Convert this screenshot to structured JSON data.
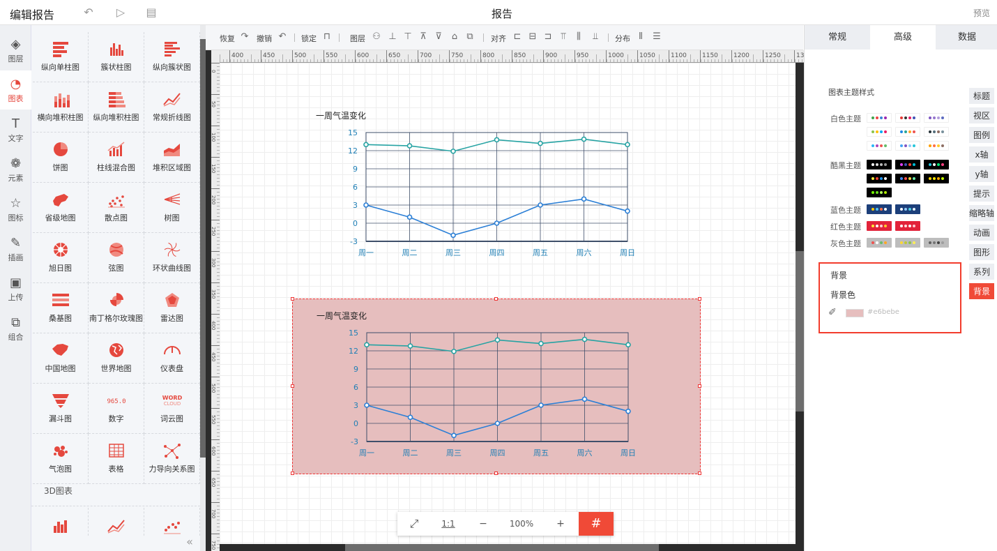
{
  "app": {
    "title": "编辑报告",
    "page_title": "报告",
    "preview": "预览"
  },
  "topbar_icons": [
    "undo-icon",
    "play-icon",
    "save-icon"
  ],
  "leftnav": [
    {
      "label": "图层",
      "icon": "layers-icon",
      "glyph": "◈"
    },
    {
      "label": "图表",
      "icon": "chart-icon",
      "glyph": "◔",
      "active": true
    },
    {
      "label": "文字",
      "icon": "text-icon",
      "glyph": "T"
    },
    {
      "label": "元素",
      "icon": "shapes-icon",
      "glyph": "❁"
    },
    {
      "label": "图标",
      "icon": "star-icon",
      "glyph": "☆"
    },
    {
      "label": "插画",
      "icon": "palette-icon",
      "glyph": "✎"
    },
    {
      "label": "上传",
      "icon": "image-upload-icon",
      "glyph": "▣"
    },
    {
      "label": "组合",
      "icon": "group-icon",
      "glyph": "⧉"
    }
  ],
  "palette": {
    "items": [
      {
        "label": "纵向单柱图",
        "icon": "bar-h-icon"
      },
      {
        "label": "簇状柱图",
        "icon": "bar-cluster-icon"
      },
      {
        "label": "纵向簇状图",
        "icon": "bar-h-cluster-icon"
      },
      {
        "label": "横向堆积柱图",
        "icon": "bar-stack-icon"
      },
      {
        "label": "纵向堆积柱图",
        "icon": "bar-h-stack-icon"
      },
      {
        "label": "常规折线图",
        "icon": "line-icon"
      },
      {
        "label": "饼图",
        "icon": "pie-icon"
      },
      {
        "label": "柱线混合图",
        "icon": "bar-line-icon"
      },
      {
        "label": "堆积区域图",
        "icon": "area-icon"
      },
      {
        "label": "省级地图",
        "icon": "province-map-icon"
      },
      {
        "label": "散点图",
        "icon": "scatter-icon"
      },
      {
        "label": "树图",
        "icon": "tree-icon"
      },
      {
        "label": "旭日图",
        "icon": "sunburst-icon"
      },
      {
        "label": "弦图",
        "icon": "chord-icon"
      },
      {
        "label": "环状曲线图",
        "icon": "ring-curve-icon"
      },
      {
        "label": "桑基图",
        "icon": "sankey-icon"
      },
      {
        "label": "南丁格尔玫瑰图",
        "icon": "rose-icon"
      },
      {
        "label": "雷达图",
        "icon": "radar-icon"
      },
      {
        "label": "中国地图",
        "icon": "china-map-icon"
      },
      {
        "label": "世界地图",
        "icon": "world-map-icon"
      },
      {
        "label": "仪表盘",
        "icon": "gauge-icon"
      },
      {
        "label": "漏斗图",
        "icon": "funnel-icon"
      },
      {
        "label": "数字",
        "icon": "number-icon"
      },
      {
        "label": "词云图",
        "icon": "wordcloud-icon"
      },
      {
        "label": "气泡图",
        "icon": "bubble-icon"
      },
      {
        "label": "表格",
        "icon": "table-icon"
      },
      {
        "label": "力导向关系图",
        "icon": "force-graph-icon"
      }
    ],
    "number_glyph": "965.0",
    "wordcloud_glyph": "WORD CLOUD",
    "section_3d": "3D图表",
    "items_3d": [
      {
        "icon": "bar-3d-icon"
      },
      {
        "icon": "line-3d-icon"
      },
      {
        "icon": "scatter-3d-icon"
      }
    ],
    "collapse": "«"
  },
  "toolbar": {
    "redo": "恢复",
    "undo": "撤销",
    "lock": "锁定",
    "layer": "图层",
    "align": "对齐",
    "distribute": "分布"
  },
  "ruler": {
    "h_labels": [
      "400",
      "450",
      "500",
      "550",
      "600",
      "650",
      "700",
      "750",
      "800",
      "850",
      "900",
      "950",
      "1000",
      "1050",
      "1100",
      "1150",
      "1200",
      "1250",
      "1300"
    ]
  },
  "zoom": {
    "fit": "⤢",
    "one_to_one": "1:1",
    "minus": "−",
    "level": "100%",
    "plus": "+",
    "grid": "#"
  },
  "right": {
    "tabs": [
      "常规",
      "高级",
      "数据"
    ],
    "active_tab": 1,
    "theme_title": "图表主题样式",
    "theme_rows": [
      {
        "label": "白色主题",
        "swatches": [
          {
            "bg": "#ffffff",
            "dots": [
              "#3fa34d",
              "#e44",
              "#3b82d6",
              "#9c27b0"
            ]
          },
          {
            "bg": "#ffffff",
            "dots": [
              "#e53935",
              "#333",
              "#e91e63",
              "#3f51b5"
            ]
          },
          {
            "bg": "#ffffff",
            "dots": [
              "#7e57c2",
              "#9575cd",
              "#b39ddb",
              "#5c6bc0"
            ]
          },
          {
            "bg": "#ffffff",
            "dots": [
              "#8bc34a",
              "#ffc107",
              "#03a9f4",
              "#e91e63"
            ]
          },
          {
            "bg": "#ffffff",
            "dots": [
              "#1e88e5",
              "#26a69a",
              "#ffa726",
              "#ef5350"
            ]
          },
          {
            "bg": "#ffffff",
            "dots": [
              "#263238",
              "#546e7a",
              "#8d6e63",
              "#78909c"
            ]
          },
          {
            "bg": "#ffffff",
            "dots": [
              "#29b6f6",
              "#ab47bc",
              "#ef5350",
              "#66bb6a"
            ]
          },
          {
            "bg": "#ffffff",
            "dots": [
              "#42a5f5",
              "#7e57c2",
              "#90caf9",
              "#26c6da"
            ]
          },
          {
            "bg": "#ffffff",
            "dots": [
              "#ffa000",
              "#ff7043",
              "#ffca28",
              "#8d6e63"
            ]
          }
        ]
      },
      {
        "label": "酷黑主题",
        "swatches": [
          {
            "bg": "#000000",
            "dots": [
              "#fff",
              "#ddd",
              "#bbb",
              "#999"
            ]
          },
          {
            "bg": "#000000",
            "dots": [
              "#e040fb",
              "#3f51b5",
              "#f44336",
              "#00bcd4"
            ]
          },
          {
            "bg": "#000000",
            "dots": [
              "#26c6da",
              "#fff",
              "#00e676",
              "#ff4081"
            ]
          },
          {
            "bg": "#000000",
            "dots": [
              "#ffeb3b",
              "#f44336",
              "#2196f3",
              "#fff"
            ]
          },
          {
            "bg": "#000000",
            "dots": [
              "#448aff",
              "#ff5252",
              "#ffd740",
              "#69f0ae"
            ]
          },
          {
            "bg": "#000000",
            "dots": [
              "#ffd600",
              "#ffea00",
              "#ffab00",
              "#c6ff00"
            ]
          },
          {
            "bg": "#000000",
            "dots": [
              "#76ff03",
              "#64dd17",
              "#b2ff59",
              "#aeea00"
            ]
          }
        ]
      },
      {
        "label": "蓝色主题",
        "swatches": [
          {
            "bg": "#1c3f7a",
            "dots": [
              "#ffcc00",
              "#4fc3f7",
              "#ff7043",
              "#fff"
            ]
          },
          {
            "bg": "#1c3f7a",
            "dots": [
              "#fff",
              "#90caf9",
              "#4dd0e1",
              "#e3f2fd"
            ]
          }
        ]
      },
      {
        "label": "红色主题",
        "swatches": [
          {
            "bg": "#e2233a",
            "dots": [
              "#ffeb3b",
              "#fff",
              "#ffcdd2",
              "#ffca28"
            ]
          },
          {
            "bg": "#e2233a",
            "dots": [
              "#fff",
              "#ffe0e0",
              "#fff",
              "#ffcdd2"
            ]
          }
        ]
      },
      {
        "label": "灰色主题",
        "swatches": [
          {
            "bg": "#bdbdbd",
            "dots": [
              "#ef5350",
              "#fff",
              "#66bb6a",
              "#ffa726"
            ]
          },
          {
            "bg": "#bdbdbd",
            "dots": [
              "#fdd835",
              "#c0ca33",
              "#8bc34a",
              "#ffee58"
            ]
          },
          {
            "bg": "#bdbdbd",
            "dots": [
              "#616161",
              "#757575",
              "#424242",
              "#9e9e9e"
            ]
          }
        ]
      }
    ],
    "side_tabs": [
      "标题",
      "视区",
      "图例",
      "x轴",
      "y轴",
      "提示",
      "缩略轴",
      "动画",
      "图形",
      "系列",
      "背景"
    ],
    "active_side_tab": 10,
    "bg_section": {
      "title": "背景",
      "label": "背景色",
      "value": "#e6bebe",
      "eyedrop": "eyedropper-icon"
    }
  },
  "chart_data": [
    {
      "type": "line",
      "title": "一周气温变化",
      "categories": [
        "周一",
        "周二",
        "周三",
        "周四",
        "周五",
        "周六",
        "周日"
      ],
      "series": [
        {
          "values": [
            13,
            12.8,
            11.9,
            13.8,
            13.2,
            13.9,
            13
          ],
          "color": "#26a3a3"
        },
        {
          "values": [
            3,
            1,
            -2,
            0,
            3,
            4,
            2
          ],
          "color": "#2b7fd6"
        }
      ],
      "yticks": [
        "15",
        "12",
        "9",
        "6",
        "3",
        "0",
        "-3"
      ],
      "ylim": [
        -3,
        15
      ],
      "background": "#ffffff"
    },
    {
      "type": "line",
      "title": "一周气温变化",
      "categories": [
        "周一",
        "周二",
        "周三",
        "周四",
        "周五",
        "周六",
        "周日"
      ],
      "series": [
        {
          "values": [
            13,
            12.8,
            11.9,
            13.8,
            13.2,
            13.9,
            13
          ],
          "color": "#26a3a3"
        },
        {
          "values": [
            3,
            1,
            -2,
            0,
            3,
            4,
            2
          ],
          "color": "#2b7fd6"
        }
      ],
      "yticks": [
        "15",
        "12",
        "9",
        "6",
        "3",
        "0",
        "-3"
      ],
      "ylim": [
        -3,
        15
      ],
      "background": "#e6bebe"
    }
  ]
}
